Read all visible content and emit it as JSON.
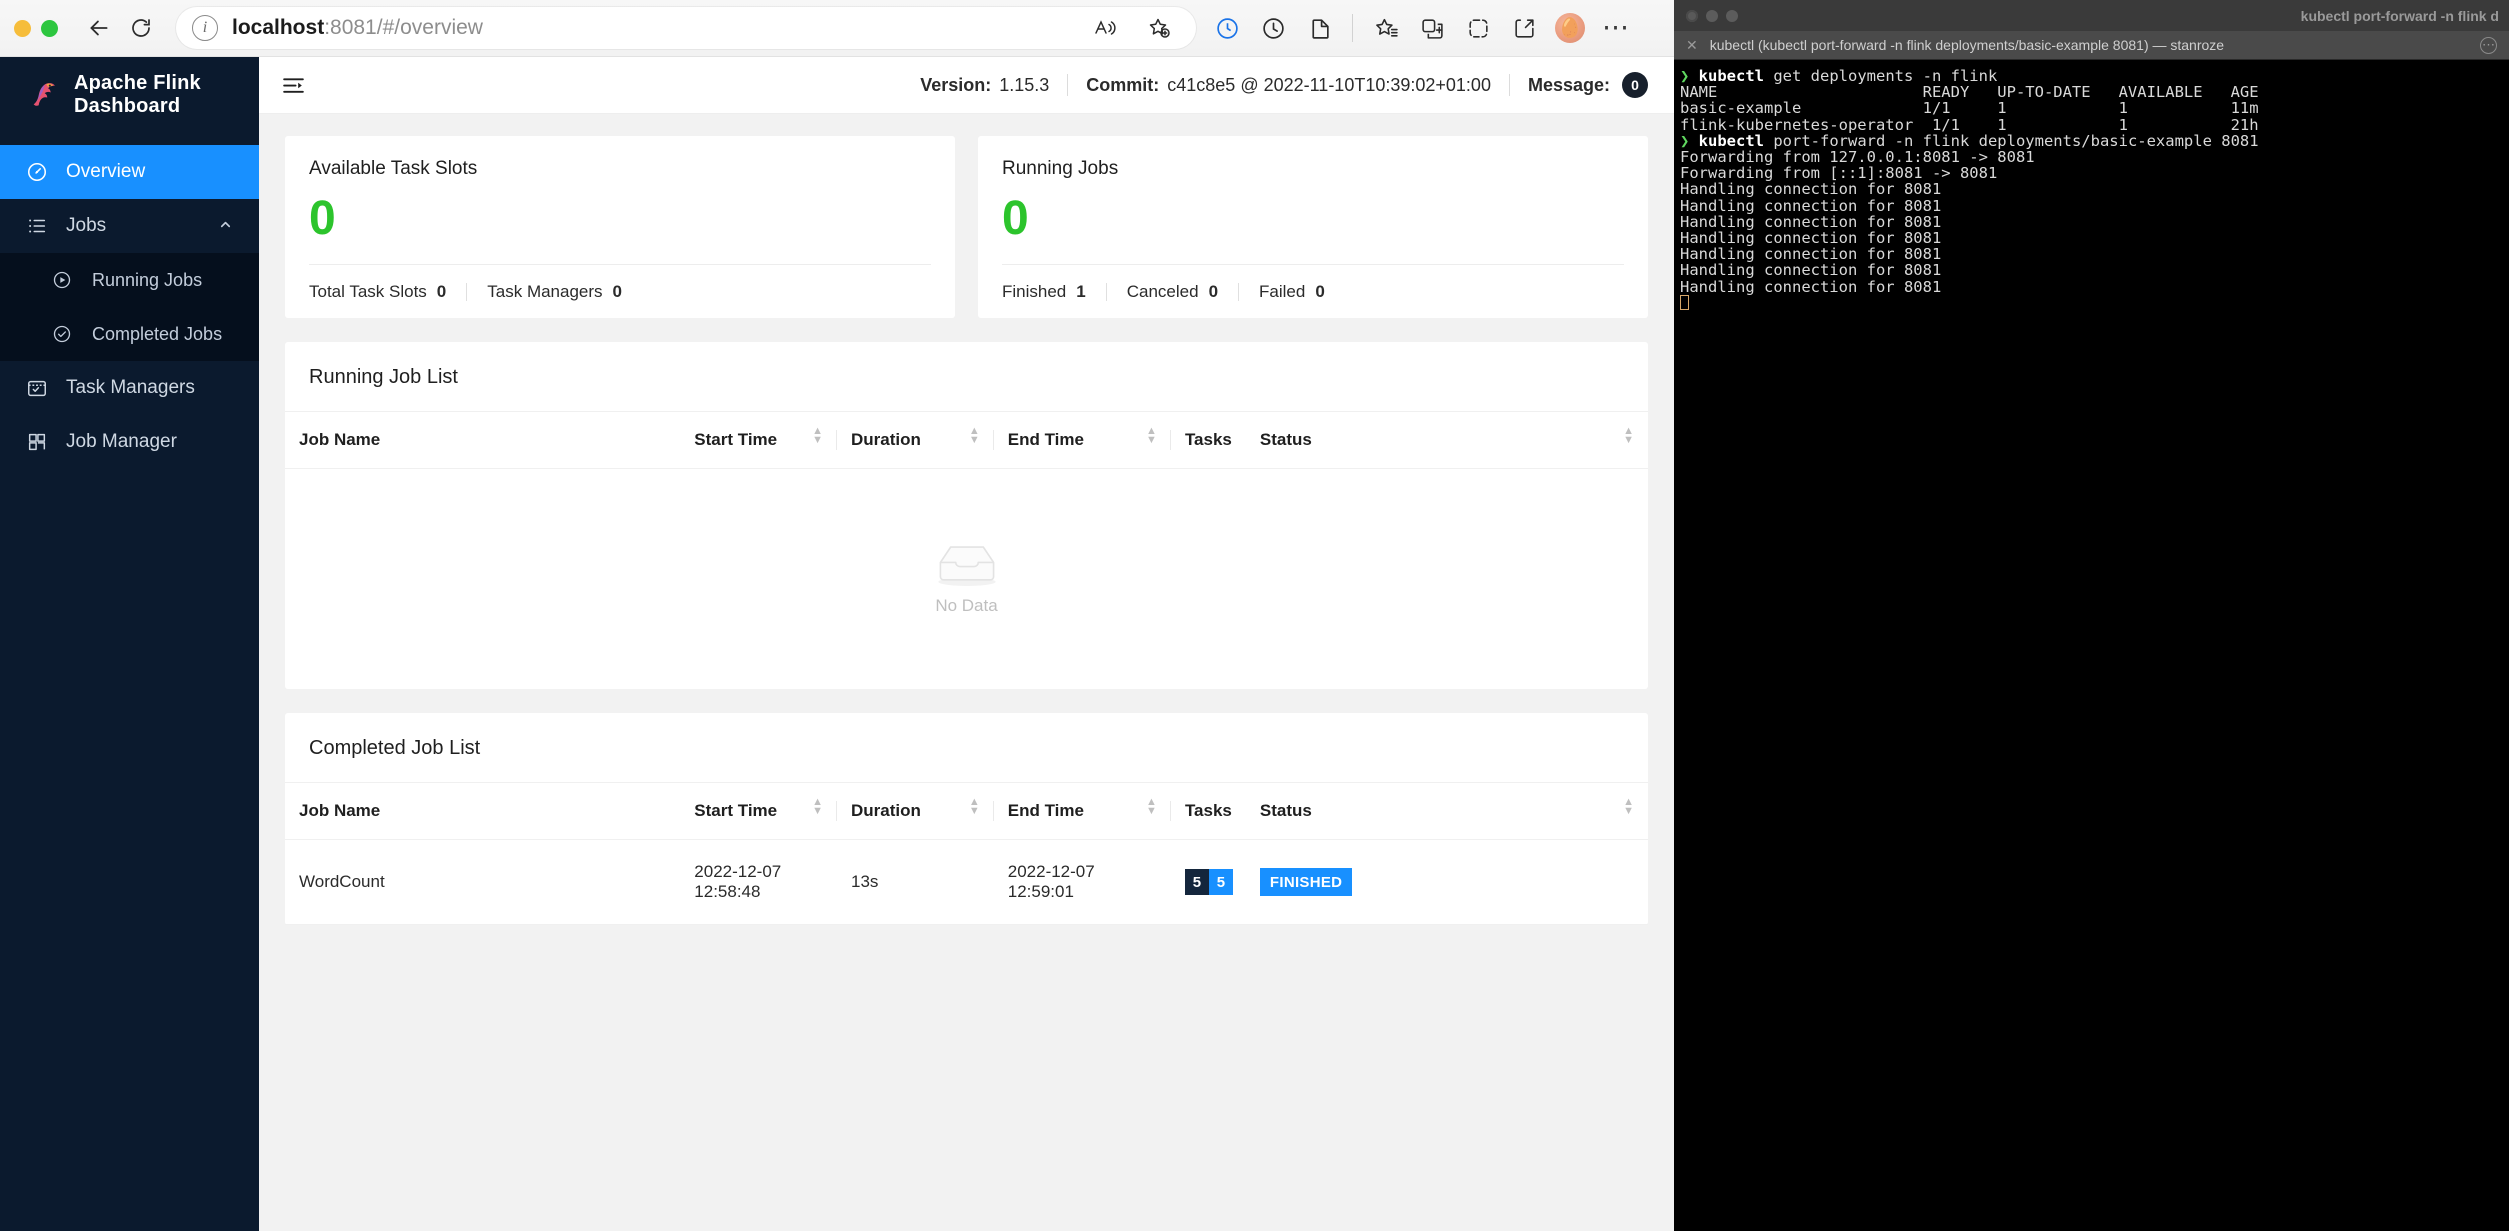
{
  "browser": {
    "url_host": "localhost",
    "url_rest": ":8081/#/overview",
    "back_icon": "back-arrow-icon",
    "reload_icon": "reload-icon",
    "info_icon": "site-info-icon",
    "toolbar_icons": [
      "read-aloud-icon",
      "add-favorite-icon",
      "tracking-prevention-icon",
      "history-icon",
      "collections-icon",
      "favorites-icon",
      "split-screen-icon",
      "browser-essentials-icon",
      "share-icon",
      "profile-avatar",
      "settings-and-more-icon"
    ]
  },
  "sidebar": {
    "brand": "Apache Flink Dashboard",
    "items": [
      {
        "label": "Overview",
        "icon": "dashboard-icon",
        "active": true
      },
      {
        "label": "Jobs",
        "icon": "list-icon",
        "active": false,
        "expanded": true
      },
      {
        "label": "Task Managers",
        "icon": "task-managers-icon",
        "active": false
      },
      {
        "label": "Job Manager",
        "icon": "job-manager-icon",
        "active": false
      }
    ],
    "jobs_subitems": [
      {
        "label": "Running Jobs",
        "icon": "play-circle-icon"
      },
      {
        "label": "Completed Jobs",
        "icon": "check-circle-icon"
      }
    ]
  },
  "topbar": {
    "fold_icon": "menu-fold-icon",
    "version_label": "Version:",
    "version_value": "1.15.3",
    "commit_label": "Commit:",
    "commit_value": "c41c8e5 @ 2022-11-10T10:39:02+01:00",
    "message_label": "Message:",
    "message_count": "0"
  },
  "cards": [
    {
      "title": "Available Task Slots",
      "value": "0",
      "footer": [
        {
          "label": "Total Task Slots",
          "value": "0"
        },
        {
          "label": "Task Managers",
          "value": "0"
        }
      ]
    },
    {
      "title": "Running Jobs",
      "value": "0",
      "footer": [
        {
          "label": "Finished",
          "value": "1"
        },
        {
          "label": "Canceled",
          "value": "0"
        },
        {
          "label": "Failed",
          "value": "0"
        }
      ]
    }
  ],
  "running_panel": {
    "title": "Running Job List",
    "columns": [
      "Job Name",
      "Start Time",
      "Duration",
      "End Time",
      "Tasks",
      "Status"
    ],
    "empty_text": "No Data",
    "empty_icon": "empty-inbox-icon",
    "rows": []
  },
  "completed_panel": {
    "title": "Completed Job List",
    "columns": [
      "Job Name",
      "Start Time",
      "Duration",
      "End Time",
      "Tasks",
      "Status"
    ],
    "rows": [
      {
        "job_name": "WordCount",
        "start_time": "2022-12-07 12:58:48",
        "duration": "13s",
        "end_time": "2022-12-07 12:59:01",
        "tasks_total": "5",
        "tasks_finished": "5",
        "status": "FINISHED"
      }
    ]
  },
  "terminal": {
    "window_title": "kubectl port-forward -n flink d",
    "tab_title": "kubectl (kubectl port-forward -n flink deployments/basic-example 8081) — stanroze",
    "close_icon": "close-icon",
    "more_icon": "more-options-icon",
    "lines": [
      {
        "prompt": "❯ ",
        "cmd": "kubectl",
        "rest": " get deployments -n flink"
      },
      {
        "text": "NAME                      READY   UP-TO-DATE   AVAILABLE   AGE"
      },
      {
        "text": "basic-example             1/1     1            1           11m"
      },
      {
        "text": "flink-kubernetes-operator  1/1    1            1           21h"
      },
      {
        "prompt": "❯ ",
        "cmd": "kubectl",
        "rest": " port-forward -n flink deployments/basic-example 8081"
      },
      {
        "text": "Forwarding from 127.0.0.1:8081 -> 8081"
      },
      {
        "text": "Forwarding from [::1]:8081 -> 8081"
      },
      {
        "text": "Handling connection for 8081"
      },
      {
        "text": "Handling connection for 8081"
      },
      {
        "text": "Handling connection for 8081"
      },
      {
        "text": "Handling connection for 8081"
      },
      {
        "text": "Handling connection for 8081"
      },
      {
        "text": "Handling connection for 8081"
      },
      {
        "text": "Handling connection for 8081"
      }
    ]
  },
  "colors": {
    "accent_blue": "#1890ff",
    "sidebar_bg": "#0b1a2e",
    "success_green": "#2cc42c",
    "badge_dark": "#14263c"
  }
}
